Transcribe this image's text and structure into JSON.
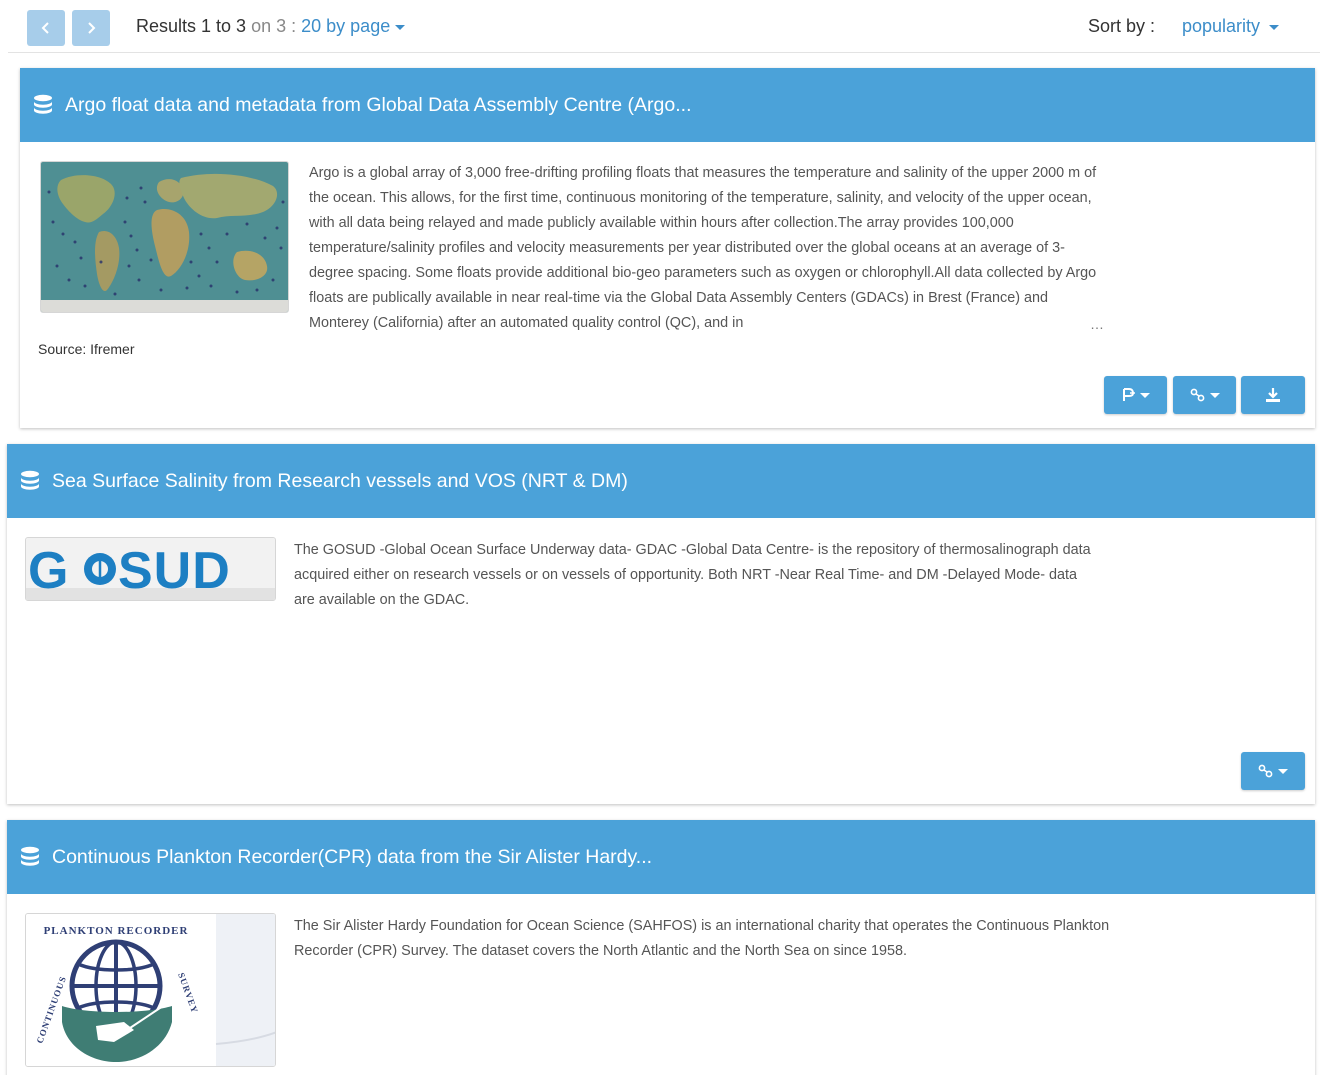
{
  "toolbar": {
    "prev_label": "‹",
    "next_label": "›",
    "results_prefix": "Results 1 to 3",
    "results_on": "on 3 :",
    "per_page": "20 by page",
    "sort_label": "Sort by :",
    "sort_value": "popularity"
  },
  "colors": {
    "header_blue": "#4ba2d9",
    "link_blue": "#3c8dc9",
    "pager_disabled": "#a7cdea"
  },
  "results": [
    {
      "title": "Argo float data and metadata from Global Data Assembly Centre (Argo...",
      "icon": "database-icon",
      "thumbnail": "world-map-argo-floats",
      "description": "Argo is a global array of 3,000 free-drifting profiling floats that measures the temperature and salinity of the upper 2000 m of the ocean. This allows, for the first time, continuous monitoring of the temperature, salinity, and velocity of the upper ocean, with all data being relayed and made publicly available within hours after collection.The array provides 100,000 temperature/salinity profiles and velocity measurements per year distributed over the global oceans at an average of 3-degree spacing. Some floats provide additional bio-geo parameters such as oxygen or chlorophyll.All data collected by Argo floats are publically available in near real-time via the Global Data Assembly Centers (GDACs) in Brest (France) and Monterey (California) after an automated quality control (QC), and in",
      "ellipsis": "…",
      "source": "Source: Ifremer",
      "actions": [
        "parameters-dropdown-icon",
        "links-dropdown-icon",
        "download-icon"
      ]
    },
    {
      "title": "Sea Surface Salinity from Research vessels and VOS (NRT & DM)",
      "icon": "database-icon",
      "thumbnail": "gosud-logo",
      "logo_text": "G◎SUD",
      "description": "The GOSUD -Global Ocean Surface Underway data- GDAC -Global Data Centre- is the repository of thermosalinograph data acquired either on research vessels or on vessels of opportunity. Both NRT -Near Real Time- and DM -Delayed Mode- data are available on the GDAC.",
      "actions": [
        "links-dropdown-icon"
      ]
    },
    {
      "title": "Continuous Plankton Recorder(CPR) data from the Sir Alister Hardy...",
      "icon": "database-icon",
      "thumbnail": "cpr-survey-logo",
      "logo_text": "CONTINUOUS PLANKTON RECORDER SURVEY",
      "description": "The Sir Alister Hardy Foundation for Ocean Science (SAHFOS) is an international charity that operates the Continuous Plankton Recorder (CPR) Survey. The dataset covers the North Atlantic and the North Sea on since 1958."
    }
  ]
}
